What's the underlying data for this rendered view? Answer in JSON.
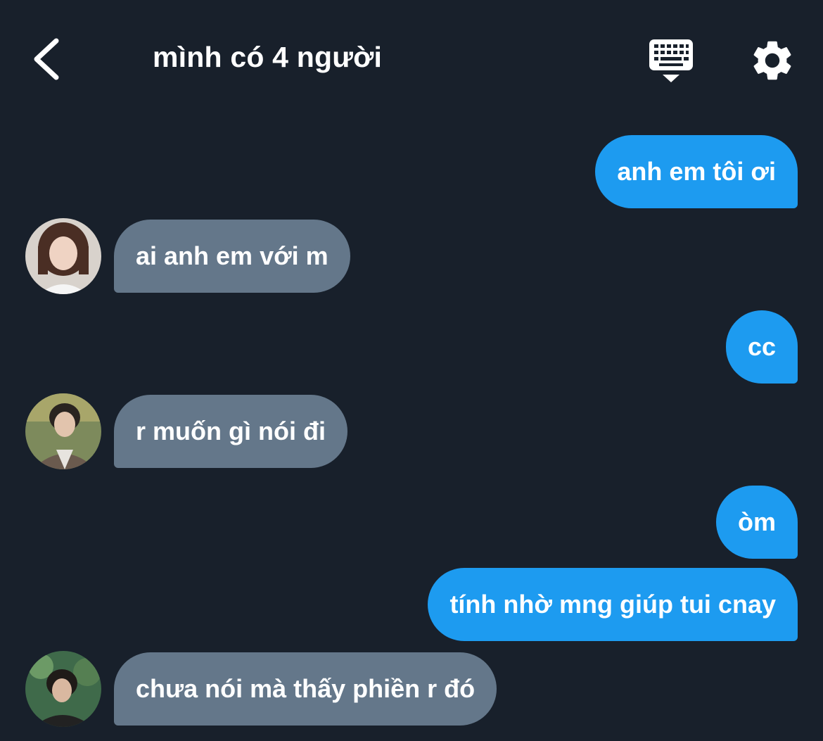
{
  "header": {
    "title": "mình có 4 người",
    "back_icon": "chevron-left-icon",
    "keyboard_icon": "keyboard-icon",
    "settings_icon": "gear-icon"
  },
  "colors": {
    "background": "#18202b",
    "outgoing_bubble": "#1d9bf0",
    "incoming_bubble": "#64778a",
    "text": "#ffffff"
  },
  "messages": [
    {
      "direction": "outgoing",
      "text": "anh em tôi ơi"
    },
    {
      "direction": "incoming",
      "text": "ai anh em với m",
      "avatar": "avatar-1"
    },
    {
      "direction": "outgoing",
      "text": "cc"
    },
    {
      "direction": "incoming",
      "text": "r muốn gì nói đi",
      "avatar": "avatar-2"
    },
    {
      "direction": "outgoing",
      "text": "òm"
    },
    {
      "direction": "outgoing",
      "text": "tính nhờ mng giúp tui cnay"
    },
    {
      "direction": "incoming",
      "text": "chưa nói mà thấy phiền r đó",
      "avatar": "avatar-3"
    }
  ]
}
